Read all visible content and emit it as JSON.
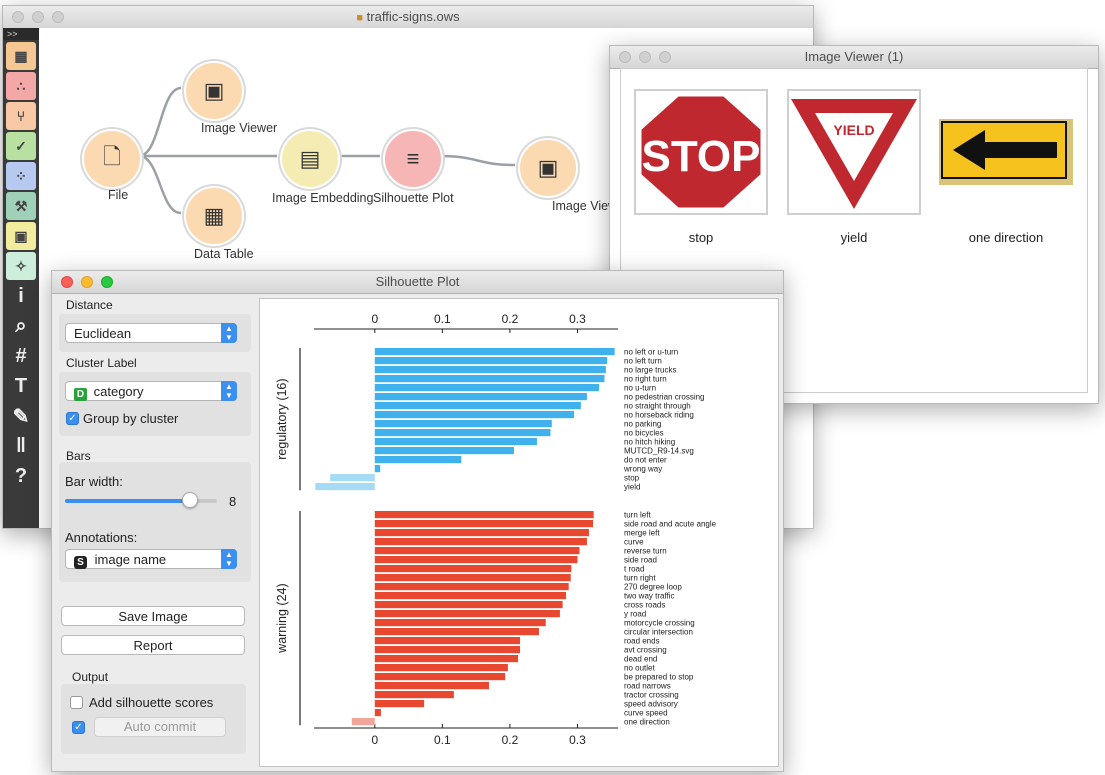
{
  "canvas_window": {
    "title": "traffic-signs.ows",
    "toolbox_toggle": ">>",
    "toolbox": [
      {
        "icon": "data-icon",
        "color": "#f5c793"
      },
      {
        "icon": "visualize-icon",
        "color": "#f4a7a7"
      },
      {
        "icon": "model-icon",
        "color": "#f9c9a5"
      },
      {
        "icon": "evaluate-icon",
        "color": "#b8e0a1"
      },
      {
        "icon": "unsupervised-icon",
        "color": "#b7c9f1"
      },
      {
        "icon": "image-analytics-icon",
        "color": "#9ed1b8"
      },
      {
        "icon": "image-icon",
        "color": "#f2ec9f"
      },
      {
        "icon": "spectroscopy-icon",
        "color": "#cdeeda"
      },
      {
        "icon": "info-icon",
        "color": null
      },
      {
        "icon": "search-icon",
        "color": null
      },
      {
        "icon": "grid-icon",
        "color": null
      },
      {
        "icon": "text-icon",
        "color": null
      },
      {
        "icon": "pen-icon",
        "color": null
      },
      {
        "icon": "pause-icon",
        "color": null
      },
      {
        "icon": "help-icon",
        "color": null
      }
    ],
    "widgets": [
      {
        "id": "file",
        "label": "File",
        "color": "#fbd9b1"
      },
      {
        "id": "image-viewer",
        "label": "Image Viewer",
        "color": "#fbd9b1"
      },
      {
        "id": "data-table",
        "label": "Data Table",
        "color": "#fbd9b1"
      },
      {
        "id": "image-embedding",
        "label": "Image Embedding",
        "color": "#f5ecb3"
      },
      {
        "id": "silhouette-plot",
        "label": "Silhouette Plot",
        "color": "#f6b6b6"
      },
      {
        "id": "image-viewer-1",
        "label": "Image Viewer (1)",
        "color": "#fbd9b1"
      }
    ]
  },
  "image_viewer_window": {
    "title": "Image Viewer (1)",
    "items": [
      {
        "label": "stop",
        "sign_text": "STOP"
      },
      {
        "label": "yield",
        "sign_text": "YIELD"
      },
      {
        "label": "one direction",
        "sign_text": ""
      }
    ]
  },
  "silhouette_window": {
    "title": "Silhouette Plot",
    "distance": {
      "title": "Distance",
      "value": "Euclidean"
    },
    "cluster_label": {
      "title": "Cluster Label",
      "value": "category",
      "badge": "D",
      "group_by_cluster": "Group by cluster",
      "group_checked": true
    },
    "bars": {
      "title": "Bars",
      "bar_width_label": "Bar width:",
      "bar_width_value": "8",
      "bar_width_fraction": 0.82,
      "annotations_label": "Annotations:",
      "annotation_value": "image name",
      "annotation_badge": "S"
    },
    "buttons": {
      "save": "Save Image",
      "report": "Report"
    },
    "output": {
      "title": "Output",
      "add_scores": "Add silhouette scores",
      "add_checked": false,
      "auto_commit": "Auto commit",
      "auto_checked": true
    }
  },
  "chart_data": {
    "type": "bar",
    "orientation": "horizontal",
    "xlim": [
      -0.09,
      0.36
    ],
    "ticks": [
      "0",
      "0.1",
      "0.2",
      "0.3"
    ],
    "tick_values": [
      0,
      0.1,
      0.2,
      0.3
    ],
    "series": [
      {
        "name": "regulatory (16)",
        "color": "#3fb1ec",
        "negative_color": "#a6dbf6",
        "categories": [
          "no left or u-turn",
          "no left turn",
          "no large trucks",
          "no right turn",
          "no u-turn",
          "no pedestrian crossing",
          "no straight through",
          "no horseback riding",
          "no parking",
          "no bicycles",
          "no hitch hiking",
          "MUTCD_R9-14.svg",
          "do not enter",
          "wrong way",
          "stop",
          "yield"
        ],
        "values": [
          0.355,
          0.344,
          0.342,
          0.34,
          0.332,
          0.314,
          0.305,
          0.295,
          0.262,
          0.26,
          0.24,
          0.206,
          0.128,
          0.008,
          -0.066,
          -0.088
        ]
      },
      {
        "name": "warning (24)",
        "color": "#e84730",
        "negative_color": "#f2a69b",
        "categories": [
          "turn left",
          "side road and acute angle",
          "merge left",
          "curve",
          "reverse turn",
          "side road",
          "t road",
          "turn right",
          "270 degree loop",
          "two way traffic",
          "cross roads",
          "y road",
          "motorcycle crossing",
          "circular intersection",
          "road ends",
          "avt crossing",
          "dead end",
          "no outlet",
          "be prepared to stop",
          "road narrows",
          "tractor crossing",
          "speed advisory",
          "curve speed",
          "one direction"
        ],
        "values": [
          0.324,
          0.323,
          0.317,
          0.314,
          0.303,
          0.3,
          0.291,
          0.29,
          0.287,
          0.283,
          0.278,
          0.274,
          0.253,
          0.243,
          0.215,
          0.215,
          0.212,
          0.197,
          0.193,
          0.169,
          0.117,
          0.073,
          0.009,
          -0.034
        ]
      }
    ]
  }
}
